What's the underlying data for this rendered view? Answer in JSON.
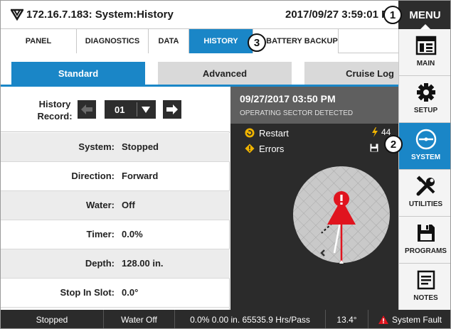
{
  "header": {
    "title": "172.16.7.183: System:History",
    "datetime": "2017/09/27 3:59:01 PM",
    "menu_label": "MENU"
  },
  "nav_tabs": [
    {
      "label": "PANEL",
      "active": false
    },
    {
      "label": "DIAGNOSTICS",
      "active": false
    },
    {
      "label": "DATA",
      "active": false
    },
    {
      "label": "HISTORY",
      "active": true
    },
    {
      "label": "BATTERY BACKUP",
      "active": false
    }
  ],
  "sub_tabs": [
    {
      "label": "Standard",
      "active": true
    },
    {
      "label": "Advanced",
      "active": false
    },
    {
      "label": "Cruise Log",
      "active": false
    }
  ],
  "history": {
    "record_label": "History Record:",
    "record_value": "01",
    "fields": [
      {
        "label": "System:",
        "value": "Stopped"
      },
      {
        "label": "Direction:",
        "value": "Forward"
      },
      {
        "label": "Water:",
        "value": "Off"
      },
      {
        "label": "Timer:",
        "value": "0.0%"
      },
      {
        "label": "Depth:",
        "value": "128.00 in."
      },
      {
        "label": "Stop In Slot:",
        "value": "0.0°"
      }
    ]
  },
  "event": {
    "datetime": "09/27/2017 03:50 PM",
    "description": "OPERATING SECTOR DETECTED",
    "items": [
      {
        "label": "Restart",
        "icon": "restart-icon"
      },
      {
        "label": "Errors",
        "icon": "warning-icon"
      }
    ],
    "restart_extra": "44"
  },
  "sidebar": [
    {
      "label": "MAIN",
      "icon": "main-panel-icon",
      "active": false
    },
    {
      "label": "SETUP",
      "icon": "gear-icon",
      "active": false
    },
    {
      "label": "SYSTEM",
      "icon": "system-icon",
      "active": true
    },
    {
      "label": "UTILITIES",
      "icon": "tools-icon",
      "active": false
    },
    {
      "label": "PROGRAMS",
      "icon": "save-icon",
      "active": false
    },
    {
      "label": "NOTES",
      "icon": "notes-icon",
      "active": false
    }
  ],
  "statusbar": {
    "system": "Stopped",
    "water": "Water Off",
    "metrics": "0.0%  0.00 in.  65535.9 Hrs/Pass",
    "angle": "13.4°",
    "fault": "System Fault"
  },
  "callouts": [
    "1",
    "2",
    "3"
  ],
  "colors": {
    "accent": "#1a86c7",
    "dark": "#2b2b2b",
    "alert": "#e0141e",
    "warning": "#f0b400"
  }
}
